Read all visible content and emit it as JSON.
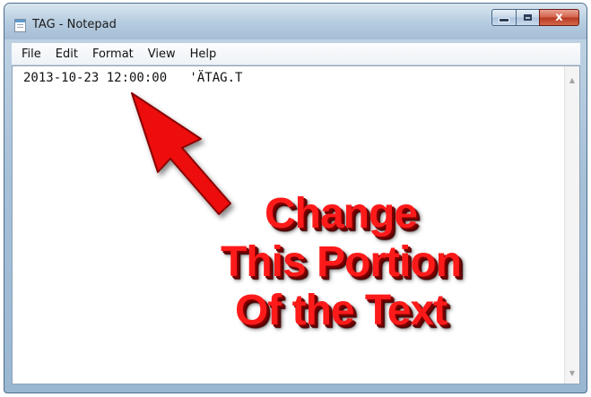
{
  "window": {
    "title": "TAG - Notepad",
    "controls": {
      "minimize": "",
      "maximize": "",
      "close": "x"
    }
  },
  "menu": [
    "File",
    "Edit",
    "Format",
    "View",
    "Help"
  ],
  "editor": {
    "content": "2013-10-23 12:00:00   'ÄTAG.T"
  },
  "scrollbar": {
    "up_glyph": "▲",
    "down_glyph": "▼"
  },
  "annotation": {
    "lines": [
      "Change",
      "This Portion",
      "Of the Text"
    ],
    "color": "#ff1a1a"
  }
}
